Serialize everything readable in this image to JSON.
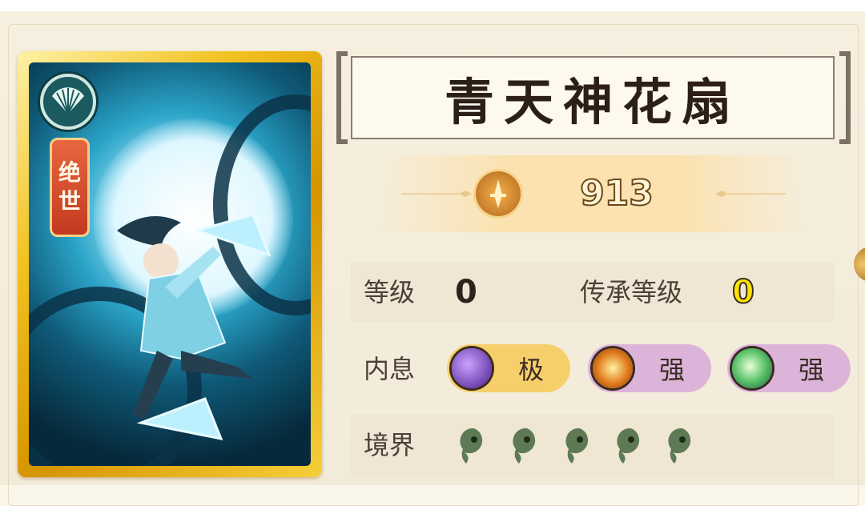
{
  "card": {
    "emblem_icon": "fan-icon",
    "rarity_badge": [
      "绝",
      "世"
    ]
  },
  "weapon": {
    "name": "青天神花扇",
    "power_icon": "sword-emblem-icon",
    "power": "913"
  },
  "stats": {
    "level_label": "等级",
    "level_value": "0",
    "inherit_label": "传承等级",
    "inherit_value": "0"
  },
  "inner_breath": {
    "label": "内息",
    "slots": [
      {
        "icon": "purple-moon-icon",
        "text": "极",
        "bg": "#f6cf6a"
      },
      {
        "icon": "sun-orb-icon",
        "text": "强",
        "bg": "#dcb3d9"
      },
      {
        "icon": "green-crescent-icon",
        "text": "强",
        "bg": "#dcb3d9"
      }
    ]
  },
  "realm": {
    "label": "境界",
    "marks": [
      "magatama-icon",
      "magatama-icon",
      "magatama-icon",
      "magatama-icon",
      "magatama-icon"
    ]
  },
  "colors": {
    "card_gold": "#f2c11f",
    "badge_red": "#d2482a",
    "jade": "#5e7a55",
    "power_text_outline": "#6c4a1d"
  }
}
